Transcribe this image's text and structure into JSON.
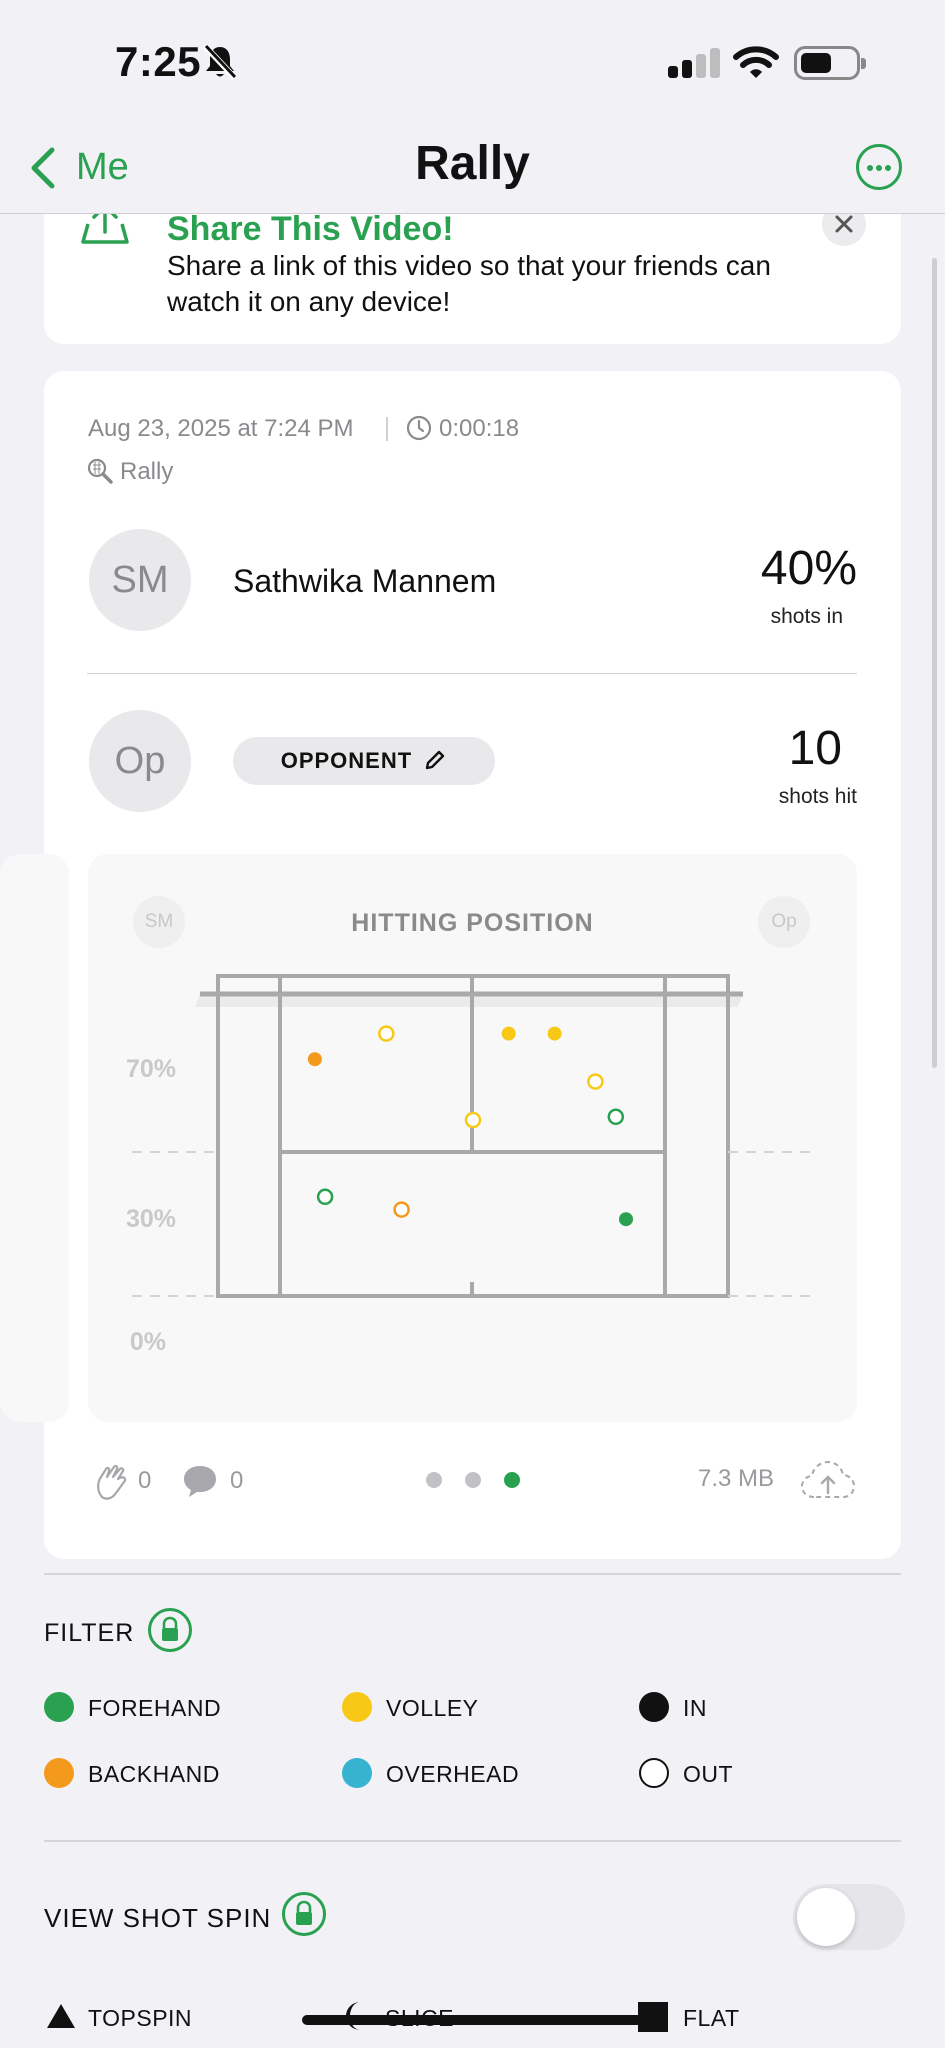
{
  "status_bar": {
    "time": "7:25"
  },
  "nav": {
    "back_label": "Me",
    "title": "Rally"
  },
  "share_banner": {
    "title": "Share This Video!",
    "text_line1": "Share a link of this video so that your friends can",
    "text_line2": "watch it on any device!"
  },
  "session": {
    "date": "Aug 23, 2025 at 7:24 PM",
    "duration": "0:00:18",
    "type": "Rally",
    "player": {
      "initials": "SM",
      "name": "Sathwika Mannem",
      "stat_value": "40%",
      "stat_label": "shots in"
    },
    "opponent": {
      "initials": "Op",
      "label": "OPPONENT",
      "stat_value": "10",
      "stat_label": "shots hit"
    }
  },
  "chart": {
    "title": "HITTING POSITION",
    "left_avatar": "SM",
    "right_avatar": "Op",
    "y_labels": [
      "70%",
      "30%",
      "0%"
    ]
  },
  "chart_data": {
    "type": "scatter",
    "title": "HITTING POSITION",
    "y_ticks": [
      "0%",
      "30%",
      "70%"
    ],
    "points": [
      {
        "x": 0.19,
        "y": 0.74,
        "color": "#f39a1c",
        "filled": true
      },
      {
        "x": 0.33,
        "y": 0.82,
        "color": "#f8c817",
        "filled": false
      },
      {
        "x": 0.57,
        "y": 0.82,
        "color": "#f8c817",
        "filled": true
      },
      {
        "x": 0.66,
        "y": 0.82,
        "color": "#f8c817",
        "filled": true
      },
      {
        "x": 0.74,
        "y": 0.67,
        "color": "#f8c817",
        "filled": false
      },
      {
        "x": 0.5,
        "y": 0.55,
        "color": "#f8c817",
        "filled": false
      },
      {
        "x": 0.78,
        "y": 0.56,
        "color": "#2aa150",
        "filled": false
      },
      {
        "x": 0.21,
        "y": 0.31,
        "color": "#2aa150",
        "filled": false
      },
      {
        "x": 0.36,
        "y": 0.27,
        "color": "#f39a1c",
        "filled": false
      },
      {
        "x": 0.8,
        "y": 0.24,
        "color": "#2aa150",
        "filled": true
      }
    ]
  },
  "footer": {
    "likes": "0",
    "comments": "0",
    "size": "7.3 MB",
    "page_count": 3,
    "active_page": 2
  },
  "filter": {
    "title": "FILTER",
    "items": [
      {
        "label": "FOREHAND",
        "color": "#2aa150",
        "style": "filled"
      },
      {
        "label": "VOLLEY",
        "color": "#f8c817",
        "style": "filled"
      },
      {
        "label": "IN",
        "color": "#111111",
        "style": "filled"
      },
      {
        "label": "BACKHAND",
        "color": "#f39a1c",
        "style": "filled"
      },
      {
        "label": "OVERHEAD",
        "color": "#35b3cf",
        "style": "filled"
      },
      {
        "label": "OUT",
        "color": "#111111",
        "style": "outline"
      }
    ]
  },
  "spin": {
    "title": "VIEW SHOT SPIN",
    "toggle_on": false,
    "legend": [
      "TOPSPIN",
      "SLICE",
      "FLAT"
    ]
  },
  "colors": {
    "accent": "#2aa150",
    "background": "#f2f2f6"
  }
}
